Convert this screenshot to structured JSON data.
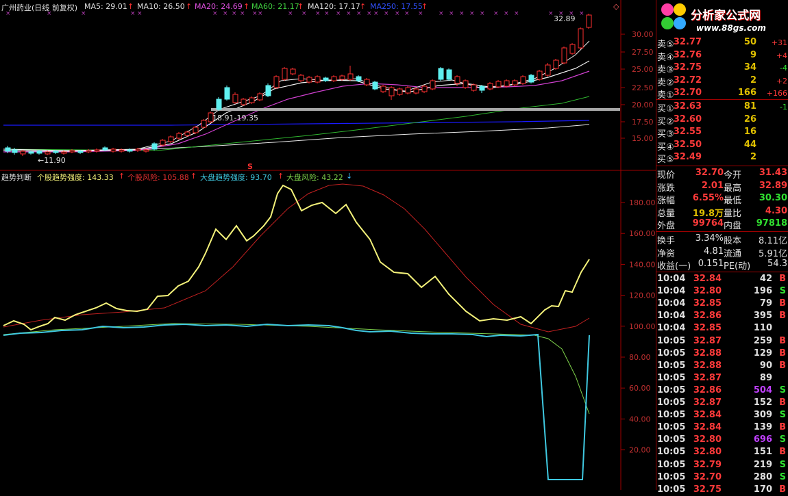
{
  "stock_header": {
    "name": "广州药业(日线 前复权)",
    "ma5": "MA5: 29.01",
    "ma10": "MA10: 26.50",
    "ma20": "MA20: 24.69",
    "ma60": "MA60: 21.17",
    "ma120": "MA120: 17.17",
    "ma250": "MA250: 17.55",
    "up_arrow": "↑",
    "corner": "◇"
  },
  "price_chart": {
    "high_label": "32.89",
    "range_label": "18.91-19.35",
    "low_label": "←11.90",
    "s_marker": "S",
    "axis_ticks": [
      "30.00",
      "27.50",
      "25.00",
      "22.50",
      "20.00",
      "17.50",
      "15.00"
    ]
  },
  "indicator_header": {
    "name": "趋势判断",
    "trend": "个股趋势强度: 143.33",
    "risk": "个股风险: 105.88",
    "market_trend": "大盘趋势强度: 93.70",
    "market_risk": "大盘风险: 43.22",
    "up_arrow": "↑",
    "down_arrow": "↓"
  },
  "indicator_chart": {
    "axis_ticks": [
      "180.00",
      "160.00",
      "140.00",
      "120.00",
      "100.00",
      "80.00",
      "60.00",
      "40.00",
      "20.00"
    ]
  },
  "logo": {
    "title": "分析家公式网",
    "url": "www.88gs.com"
  },
  "order_book": {
    "sell": [
      {
        "label": "卖⑤",
        "price": "32.77",
        "vol": "50",
        "chg": "+31"
      },
      {
        "label": "卖④",
        "price": "32.76",
        "vol": "9",
        "chg": "+4"
      },
      {
        "label": "卖③",
        "price": "32.75",
        "vol": "34",
        "chg": "-4"
      },
      {
        "label": "卖②",
        "price": "32.72",
        "vol": "2",
        "chg": "+2"
      },
      {
        "label": "卖①",
        "price": "32.70",
        "vol": "166",
        "chg": "+166"
      }
    ],
    "buy": [
      {
        "label": "买①",
        "price": "32.63",
        "vol": "81",
        "chg": "-1"
      },
      {
        "label": "买②",
        "price": "32.60",
        "vol": "26",
        "chg": ""
      },
      {
        "label": "买③",
        "price": "32.55",
        "vol": "16",
        "chg": ""
      },
      {
        "label": "买④",
        "price": "32.50",
        "vol": "44",
        "chg": ""
      },
      {
        "label": "买⑤",
        "price": "32.49",
        "vol": "2",
        "chg": ""
      }
    ]
  },
  "quote": [
    {
      "l1": "现价",
      "v1": "32.70",
      "l2": "今开",
      "v2": "31.43"
    },
    {
      "l1": "涨跌",
      "v1": "2.01",
      "l2": "最高",
      "v2": "32.89"
    },
    {
      "l1": "涨幅",
      "v1": "6.55%",
      "l2": "最低",
      "v2": "30.30"
    },
    {
      "l1": "总量",
      "v1": "19.8万",
      "l2": "量比",
      "v2": "4.30"
    },
    {
      "l1": "外盘",
      "v1": "99764",
      "l2": "内盘",
      "v2": "97818"
    }
  ],
  "stats": [
    {
      "l1": "换手",
      "v1": "3.34%",
      "l2": "股本",
      "v2": "8.11亿"
    },
    {
      "l1": "净资",
      "v1": "4.81",
      "l2": "流通",
      "v2": "5.91亿"
    },
    {
      "l1": "收益(一)",
      "v1": "0.151",
      "l2": "PE(动)",
      "v2": "54.3"
    }
  ],
  "ticks": [
    {
      "time": "10:04",
      "price": "32.84",
      "vol": "42",
      "side": "B"
    },
    {
      "time": "10:04",
      "price": "32.80",
      "vol": "196",
      "side": "S"
    },
    {
      "time": "10:04",
      "price": "32.85",
      "vol": "79",
      "side": "B"
    },
    {
      "time": "10:04",
      "price": "32.86",
      "vol": "395",
      "side": "B"
    },
    {
      "time": "10:04",
      "price": "32.85",
      "vol": "110",
      "side": ""
    },
    {
      "time": "10:05",
      "price": "32.87",
      "vol": "259",
      "side": "B"
    },
    {
      "time": "10:05",
      "price": "32.88",
      "vol": "129",
      "side": "B"
    },
    {
      "time": "10:05",
      "price": "32.88",
      "vol": "90",
      "side": "B"
    },
    {
      "time": "10:05",
      "price": "32.87",
      "vol": "89",
      "side": ""
    },
    {
      "time": "10:05",
      "price": "32.86",
      "vol": "504",
      "side": "S"
    },
    {
      "time": "10:05",
      "price": "32.87",
      "vol": "152",
      "side": "B"
    },
    {
      "time": "10:05",
      "price": "32.84",
      "vol": "309",
      "side": "S"
    },
    {
      "time": "10:05",
      "price": "32.84",
      "vol": "139",
      "side": "B"
    },
    {
      "time": "10:05",
      "price": "32.80",
      "vol": "696",
      "side": "S"
    },
    {
      "time": "10:05",
      "price": "32.80",
      "vol": "151",
      "side": "B"
    },
    {
      "time": "10:05",
      "price": "32.79",
      "vol": "219",
      "side": "S"
    },
    {
      "time": "10:05",
      "price": "32.70",
      "vol": "280",
      "side": "S"
    },
    {
      "time": "10:05",
      "price": "32.75",
      "vol": "170",
      "side": "B"
    }
  ]
}
